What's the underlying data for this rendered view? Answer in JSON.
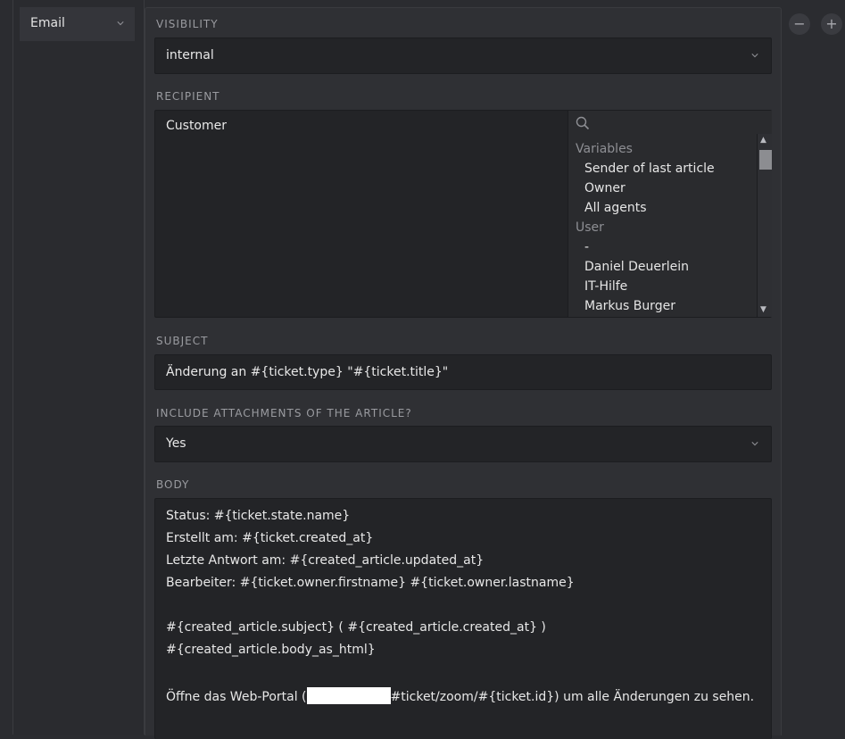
{
  "action_row": {
    "type_select": {
      "value": "Email"
    },
    "buttons": [
      {
        "symbol": "−",
        "name": "remove"
      },
      {
        "symbol": "+",
        "name": "add"
      }
    ]
  },
  "visibility": {
    "label": "Visibility",
    "value": "internal"
  },
  "recipient": {
    "label": "Recipient",
    "selected": "Customer",
    "search_placeholder": "",
    "groups": [
      {
        "name": "Variables",
        "options": [
          "Sender of last article",
          "Owner",
          "All agents"
        ]
      },
      {
        "name": "User",
        "options": [
          "-",
          "Daniel Deuerlein",
          "IT-Hilfe",
          "Markus Burger"
        ]
      }
    ]
  },
  "subject": {
    "label": "Subject",
    "value": "Änderung an #{ticket.type} \"#{ticket.title}\""
  },
  "attachments": {
    "label": "Include attachments of the article?",
    "value": "Yes"
  },
  "body": {
    "label": "Body",
    "lines": [
      "Status: #{ticket.state.name}",
      "Erstellt am: #{ticket.created_at}",
      "Letzte Antwort am: #{created_article.updated_at}",
      "Bearbeiter: #{ticket.owner.firstname} #{ticket.owner.lastname}",
      "",
      "#{created_article.subject} ( #{created_article.created_at} )",
      "#{created_article.body_as_html}",
      ""
    ],
    "portal_line_prefix": "Öffne das Web-Portal (",
    "portal_line_suffix": "#ticket/zoom/#{ticket.id}) um alle Änderungen zu sehen."
  },
  "colors": {
    "background": "#2b2c30",
    "field": "#232427",
    "text": "#e3e3e3",
    "label": "#9a9ba0"
  }
}
